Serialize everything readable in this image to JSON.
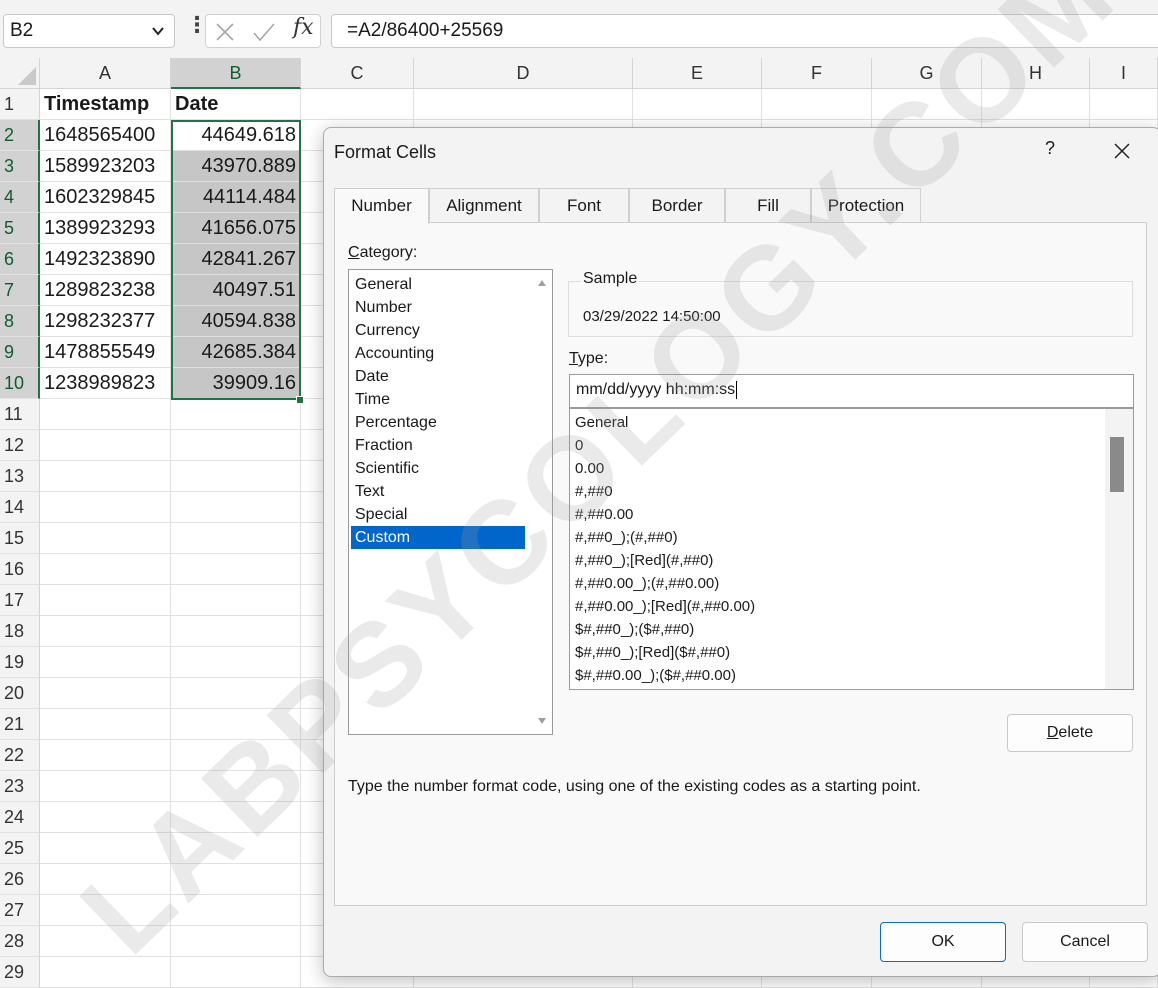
{
  "formula_bar": {
    "name_box": "B2",
    "fx_label": "fx",
    "formula": "=A2/86400+25569"
  },
  "sheet": {
    "columns": [
      "A",
      "B",
      "C",
      "D",
      "E",
      "F",
      "G",
      "H",
      "I"
    ],
    "selected_column": "B",
    "row_numbers": [
      "1",
      "2",
      "3",
      "4",
      "5",
      "6",
      "7",
      "8",
      "9",
      "10",
      "11",
      "12",
      "13",
      "14",
      "15",
      "16",
      "17",
      "18",
      "19",
      "20",
      "21",
      "22",
      "23",
      "24",
      "25",
      "26",
      "27",
      "28",
      "29"
    ],
    "header_row": [
      "Timestamp",
      "Date"
    ],
    "rows": [
      [
        "1648565400",
        "44649.618"
      ],
      [
        "1589923203",
        "43970.889"
      ],
      [
        "1602329845",
        "44114.484"
      ],
      [
        "1389923293",
        "41656.075"
      ],
      [
        "1492323890",
        "42841.267"
      ],
      [
        "1289823238",
        "40497.51"
      ],
      [
        "1298232377",
        "40594.838"
      ],
      [
        "1478855549",
        "42685.384"
      ],
      [
        "1238989823",
        "39909.16"
      ]
    ],
    "selection_color": "#217346"
  },
  "dialog": {
    "title": "Format Cells",
    "help": "?",
    "tabs": [
      "Number",
      "Alignment",
      "Font",
      "Border",
      "Fill",
      "Protection"
    ],
    "active_tab": "Number",
    "category_label_accel": "C",
    "category_label_rest": "ategory:",
    "categories": [
      "General",
      "Number",
      "Currency",
      "Accounting",
      "Date",
      "Time",
      "Percentage",
      "Fraction",
      "Scientific",
      "Text",
      "Special",
      "Custom"
    ],
    "selected_category": "Custom",
    "sample_label": "Sample",
    "sample_value": "03/29/2022 14:50:00",
    "type_label_accel": "T",
    "type_label_rest": "ype:",
    "type_value": "mm/dd/yyyy hh:mm:ss",
    "format_codes": [
      "General",
      "0",
      "0.00",
      "#,##0",
      "#,##0.00",
      "#,##0_);(#,##0)",
      "#,##0_);[Red](#,##0)",
      "#,##0.00_);(#,##0.00)",
      "#,##0.00_);[Red](#,##0.00)",
      "$#,##0_);($#,##0)",
      "$#,##0_);[Red]($#,##0)",
      "$#,##0.00_);($#,##0.00)"
    ],
    "delete_accel": "D",
    "delete_rest": "elete",
    "hint": "Type the number format code, using one of the existing codes as a starting point.",
    "ok_label": "OK",
    "cancel_label": "Cancel",
    "highlight_color": "#0066cc"
  },
  "watermark": "LABPSYCOLOGY.COM"
}
